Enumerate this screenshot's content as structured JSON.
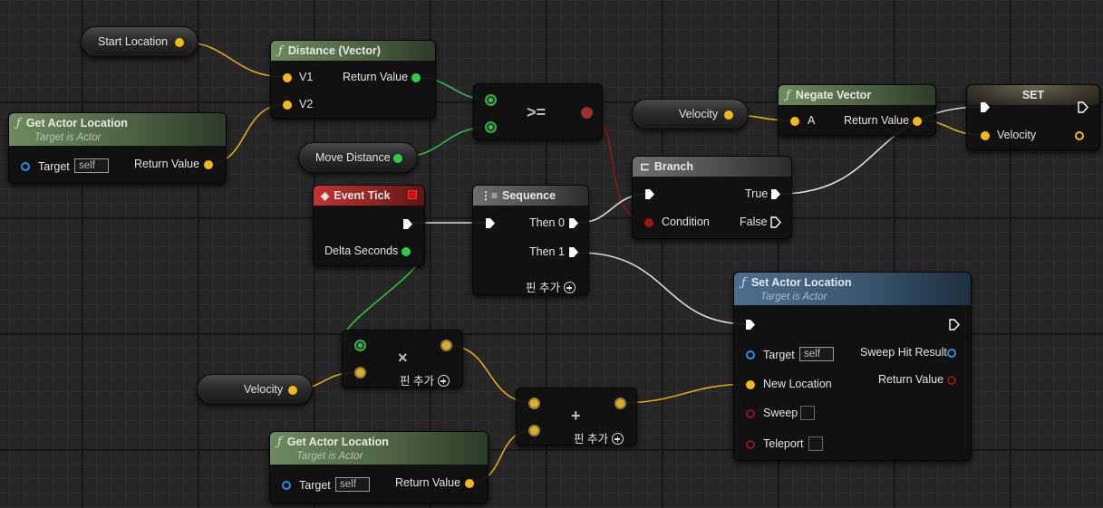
{
  "nodes": {
    "start_location": {
      "label": "Start Location"
    },
    "distance_vector": {
      "title": "Distance (Vector)",
      "pin_v1": "V1",
      "pin_v2": "V2",
      "pin_return": "Return Value"
    },
    "get_actor_location_top": {
      "title": "Get Actor Location",
      "subtitle": "Target is Actor",
      "pin_target": "Target",
      "target_value": "self",
      "pin_return": "Return Value"
    },
    "move_distance": {
      "label": "Move Distance"
    },
    "compare": {
      "operator": ">="
    },
    "velocity_top": {
      "label": "Velocity"
    },
    "negate_vector": {
      "title": "Negate Vector",
      "pin_a": "A",
      "pin_return": "Return Value"
    },
    "set_node": {
      "title": "SET",
      "pin_velocity": "Velocity"
    },
    "branch": {
      "title": "Branch",
      "pin_condition": "Condition",
      "pin_true": "True",
      "pin_false": "False"
    },
    "event_tick": {
      "title": "Event Tick",
      "pin_delta": "Delta Seconds"
    },
    "sequence": {
      "title": "Sequence",
      "pin_then0": "Then 0",
      "pin_then1": "Then 1",
      "add_pin": "핀 추가"
    },
    "set_actor_location": {
      "title": "Set Actor Location",
      "subtitle": "Target is Actor",
      "pin_target": "Target",
      "target_value": "self",
      "pin_new_location": "New Location",
      "pin_sweep": "Sweep",
      "pin_teleport": "Teleport",
      "pin_sweep_hit": "Sweep Hit Result",
      "pin_return": "Return Value"
    },
    "multiply": {
      "operator": "×",
      "add_pin": "핀 추가"
    },
    "velocity_bottom": {
      "label": "Velocity"
    },
    "add": {
      "operator": "+",
      "add_pin": "핀 추가"
    },
    "get_actor_location_bottom": {
      "title": "Get Actor Location",
      "subtitle": "Target is Actor",
      "pin_target": "Target",
      "target_value": "self",
      "pin_return": "Return Value"
    }
  },
  "colors": {
    "vector_pin": "#f3b81d",
    "float_pin": "#2fcc4a",
    "object_pin": "#2c8ed8",
    "bool_pin": "#a21313",
    "exec_pin": "#ffffff",
    "graph_background": "#262626"
  }
}
